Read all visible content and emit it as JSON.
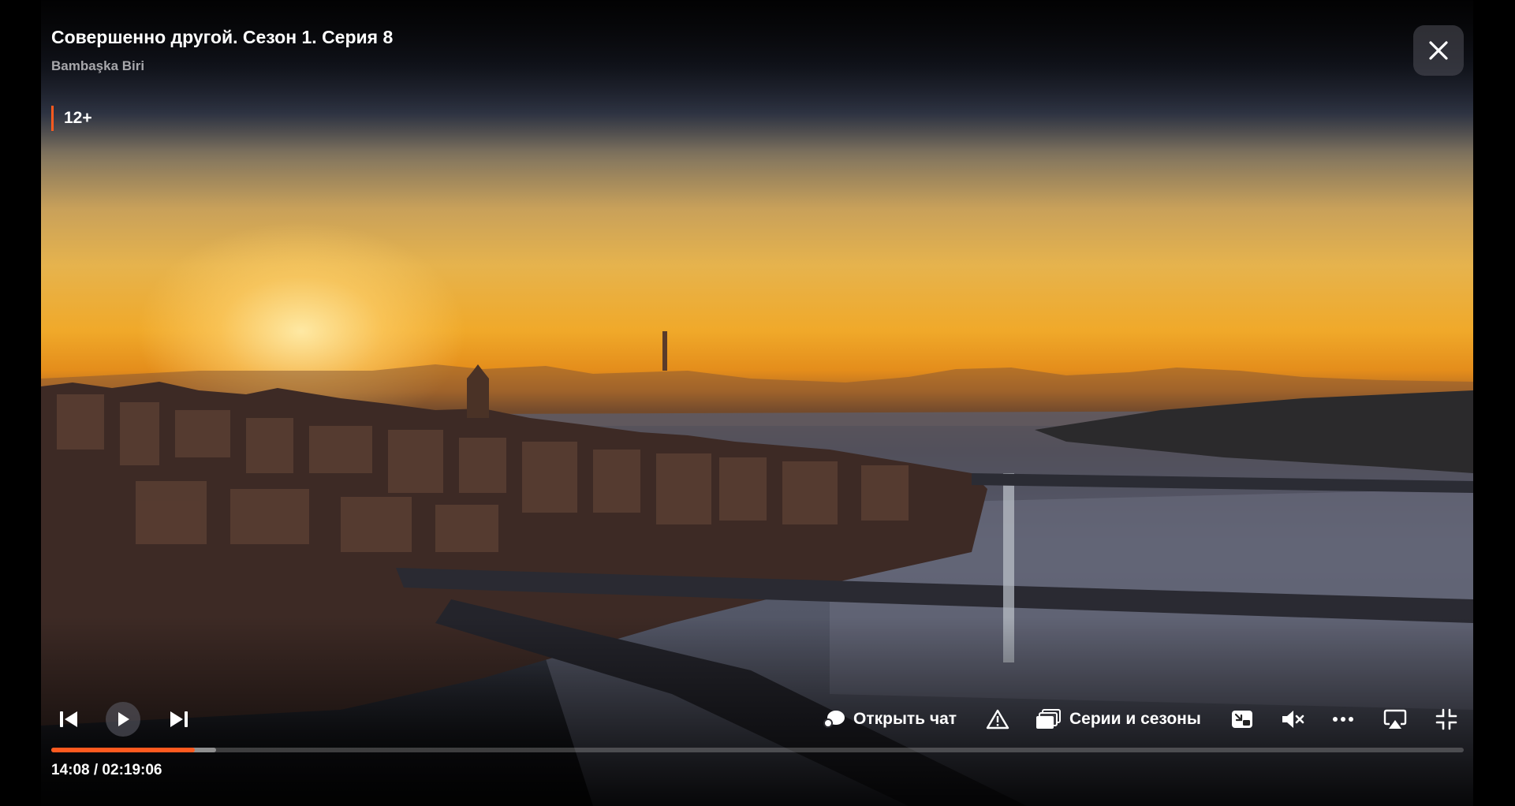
{
  "player": {
    "title": "Совершенно другой. Сезон 1. Серия 8",
    "subtitle": "Bambaşka Biri",
    "age_rating": "12+",
    "accent_color": "#ff5a1f"
  },
  "controls": {
    "chat_label": "Открыть чат",
    "episodes_label": "Серии и сезоны",
    "volume_state": "muted",
    "icons": [
      "previous-icon",
      "play-icon",
      "next-icon",
      "chat-icon",
      "warning-icon",
      "episodes-icon",
      "picture-in-picture-icon",
      "volume-muted-icon",
      "more-icon",
      "airplay-icon",
      "exit-fullscreen-icon",
      "close-icon"
    ]
  },
  "playback": {
    "time_display": "14:08 / 02:19:06",
    "progress_fraction": 0.1015,
    "buffered_fraction": 0.1165
  }
}
